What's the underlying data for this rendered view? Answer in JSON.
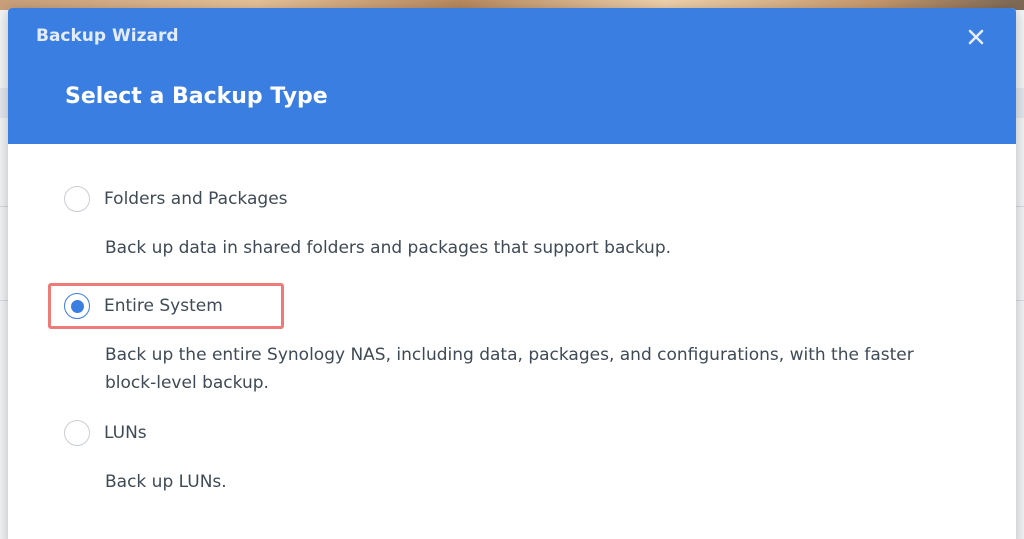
{
  "dialog": {
    "window_title": "Backup Wizard",
    "close_symbol": "✕",
    "page_title": "Select a Backup Type"
  },
  "options": [
    {
      "label": "Folders and Packages",
      "description": "Back up data in shared folders and packages that support backup.",
      "selected": false
    },
    {
      "label": "Entire System",
      "description": "Back up the entire Synology NAS, including data, packages, and configurations, with the faster block-level backup.",
      "selected": true
    },
    {
      "label": "LUNs",
      "description": "Back up LUNs.",
      "selected": false
    }
  ],
  "colors": {
    "header": "#3b7ee2",
    "radio_selected": "#3b7ee2",
    "highlight": "#ef7a7a",
    "text": "#3e4a55"
  }
}
